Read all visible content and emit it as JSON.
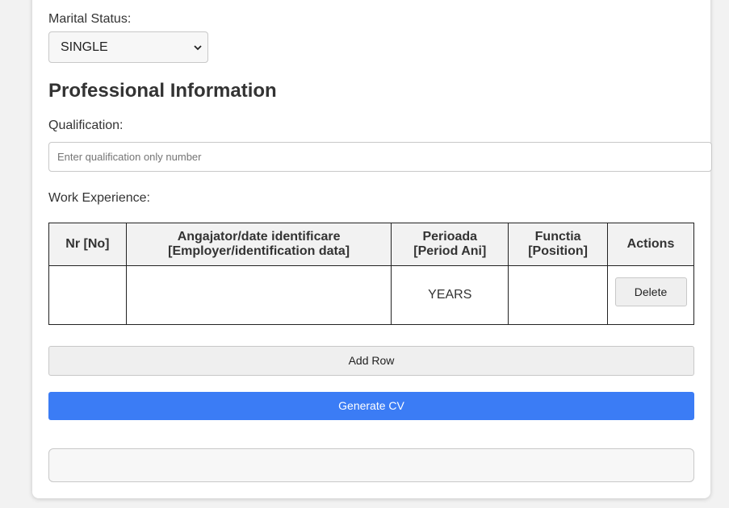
{
  "personal": {
    "marital_label": "Marital Status:",
    "marital_value": "SINGLE"
  },
  "professional": {
    "heading": "Professional Information",
    "qualification_label": "Qualification:",
    "qualification_placeholder": "Enter qualification only number",
    "work_label": "Work Experience:"
  },
  "table": {
    "headers": [
      {
        "line1": "Nr [No]",
        "line2": ""
      },
      {
        "line1": "Angajator/date identificare",
        "line2": "[Employer/identification data]"
      },
      {
        "line1": "Perioada",
        "line2": "[Period Ani]"
      },
      {
        "line1": "Functia",
        "line2": "[Position]"
      },
      {
        "line1": "Actions",
        "line2": ""
      }
    ],
    "rows": [
      {
        "nr": "",
        "employer": "",
        "period": "YEARS",
        "position": "",
        "action_label": "Delete"
      }
    ]
  },
  "buttons": {
    "add_row": "Add Row",
    "generate": "Generate CV"
  },
  "colors": {
    "accent": "#3b7cf5",
    "page_bg": "#f2f2f2",
    "card_bg": "#ffffff"
  },
  "icons": {
    "select_chevron": "chevron-down-icon"
  }
}
